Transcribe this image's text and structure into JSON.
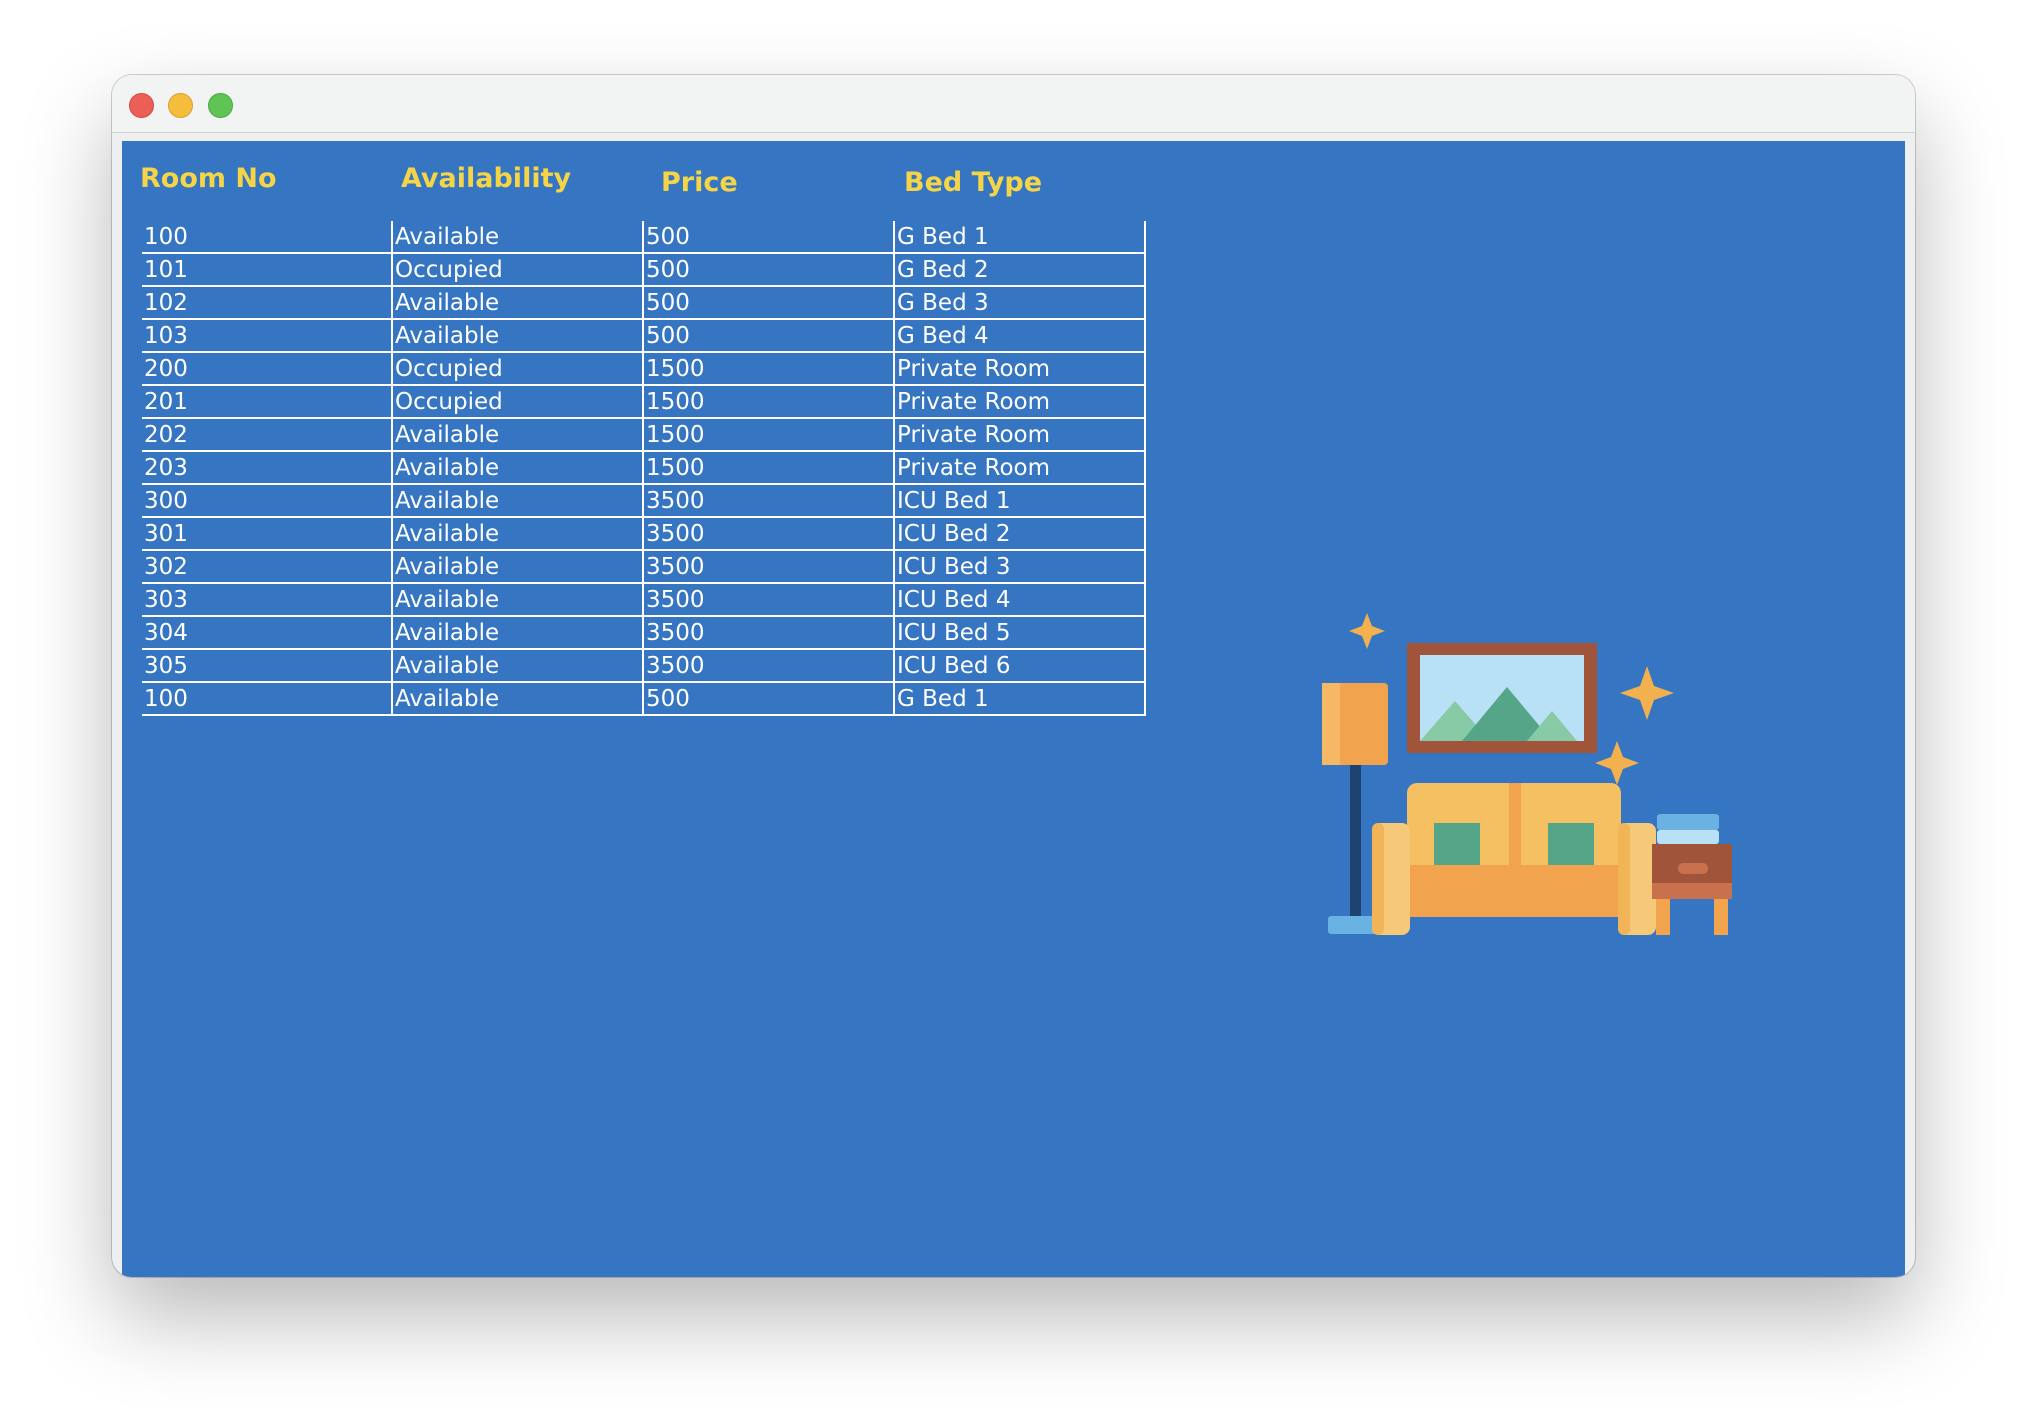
{
  "window": {
    "controls": {
      "close_color": "#ec5f57",
      "minimize_color": "#f4bd3b",
      "zoom_color": "#5fc454"
    }
  },
  "colors": {
    "background": "#3575c1",
    "header_text": "#f5d547",
    "cell_text": "#ffffff"
  },
  "table": {
    "headers": {
      "room_no": "Room No",
      "availability": "Availability",
      "price": "Price",
      "bed_type": "Bed Type"
    },
    "rows": [
      {
        "room_no": "100",
        "availability": "Available",
        "price": "500",
        "bed_type": "G Bed 1"
      },
      {
        "room_no": "101",
        "availability": "Occupied",
        "price": "500",
        "bed_type": "G Bed 2"
      },
      {
        "room_no": "102",
        "availability": "Available",
        "price": "500",
        "bed_type": "G Bed 3"
      },
      {
        "room_no": "103",
        "availability": "Available",
        "price": "500",
        "bed_type": "G Bed 4"
      },
      {
        "room_no": "200",
        "availability": "Occupied",
        "price": "1500",
        "bed_type": "Private Room"
      },
      {
        "room_no": "201",
        "availability": "Occupied",
        "price": "1500",
        "bed_type": "Private Room"
      },
      {
        "room_no": "202",
        "availability": "Available",
        "price": "1500",
        "bed_type": "Private Room"
      },
      {
        "room_no": "203",
        "availability": "Available",
        "price": "1500",
        "bed_type": "Private Room"
      },
      {
        "room_no": "300",
        "availability": "Available",
        "price": "3500",
        "bed_type": "ICU Bed 1"
      },
      {
        "room_no": "301",
        "availability": "Available",
        "price": "3500",
        "bed_type": "ICU Bed 2"
      },
      {
        "room_no": "302",
        "availability": "Available",
        "price": "3500",
        "bed_type": "ICU Bed 3"
      },
      {
        "room_no": "303",
        "availability": "Available",
        "price": "3500",
        "bed_type": "ICU Bed 4"
      },
      {
        "room_no": "304",
        "availability": "Available",
        "price": "3500",
        "bed_type": "ICU Bed 5"
      },
      {
        "room_no": "305",
        "availability": "Available",
        "price": "3500",
        "bed_type": "ICU Bed 6"
      },
      {
        "room_no": "100",
        "availability": "Available",
        "price": "500",
        "bed_type": "G Bed 1"
      }
    ]
  },
  "illustration": {
    "icon": "living-room-icon"
  }
}
